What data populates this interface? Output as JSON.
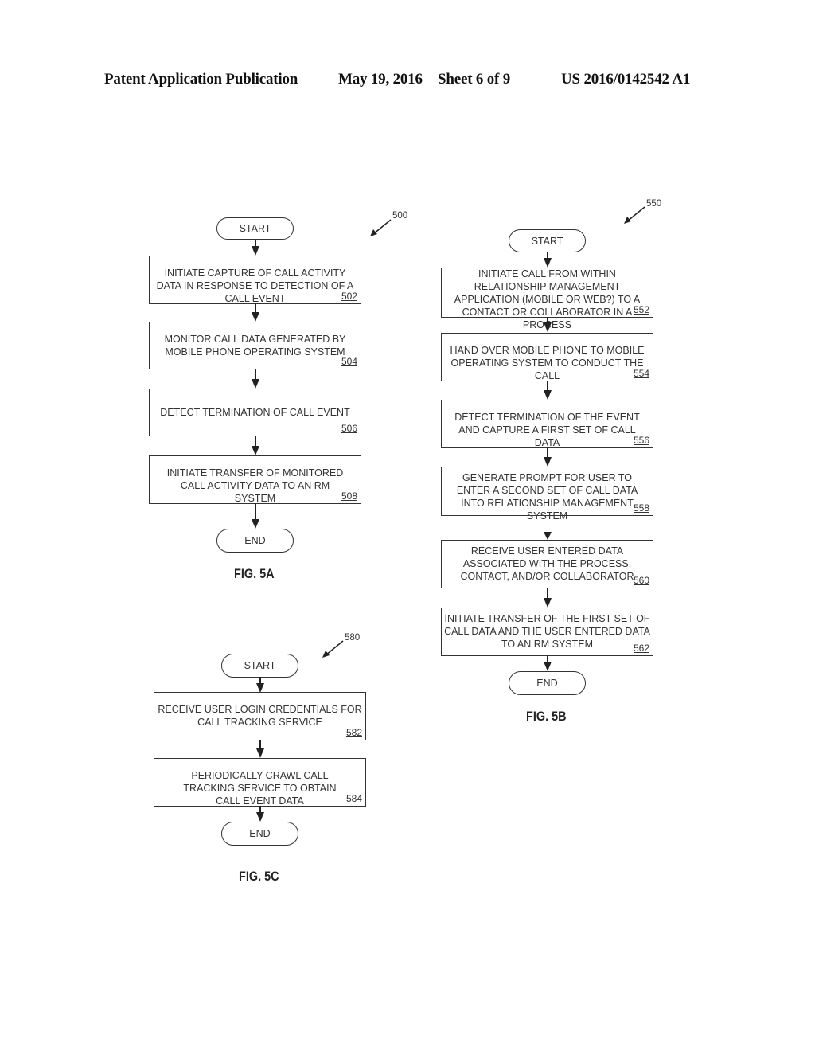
{
  "header": {
    "publication": "Patent Application Publication",
    "date": "May 19, 2016",
    "sheet": "Sheet 6 of 9",
    "number": "US 2016/0142542 A1"
  },
  "fig5a": {
    "ref": "500",
    "caption": "FIG. 5A",
    "start": "START",
    "end": "END",
    "steps": [
      {
        "text": "INITIATE CAPTURE OF CALL ACTIVITY DATA IN RESPONSE TO DETECTION OF A CALL EVENT",
        "ref": "502"
      },
      {
        "text": "MONITOR CALL DATA GENERATED BY MOBILE PHONE OPERATING SYSTEM",
        "ref": "504"
      },
      {
        "text": "DETECT TERMINATION OF CALL EVENT",
        "ref": "506"
      },
      {
        "text": "INITIATE TRANSFER OF MONITORED CALL ACTIVITY DATA TO AN RM SYSTEM",
        "ref": "508"
      }
    ]
  },
  "fig5b": {
    "ref": "550",
    "caption": "FIG. 5B",
    "start": "START",
    "end": "END",
    "steps": [
      {
        "text": "INITIATE CALL FROM WITHIN RELATIONSHIP MANAGEMENT APPLICATION (MOBILE OR WEB?) TO A CONTACT OR COLLABORATOR IN A PROCESS",
        "ref": "552"
      },
      {
        "text": "HAND OVER MOBILE PHONE TO MOBILE OPERATING SYSTEM TO CONDUCT THE CALL",
        "ref": "554"
      },
      {
        "text": "DETECT TERMINATION OF THE EVENT AND CAPTURE A FIRST SET OF CALL DATA",
        "ref": "556"
      },
      {
        "text": "GENERATE PROMPT FOR USER TO ENTER A SECOND SET OF CALL DATA INTO RELATIONSHIP MANAGEMENT SYSTEM",
        "ref": "558"
      },
      {
        "text": "RECEIVE USER ENTERED DATA ASSOCIATED WITH THE PROCESS, CONTACT, AND/OR COLLABORATOR",
        "ref": "560"
      },
      {
        "text": "INITIATE TRANSFER OF THE FIRST SET OF CALL DATA AND THE USER ENTERED DATA TO AN RM SYSTEM",
        "ref": "562"
      }
    ]
  },
  "fig5c": {
    "ref": "580",
    "caption": "FIG. 5C",
    "start": "START",
    "end": "END",
    "steps": [
      {
        "text": "RECEIVE USER LOGIN CREDENTIALS FOR CALL TRACKING SERVICE",
        "ref": "582"
      },
      {
        "text": "PERIODICALLY CRAWL CALL TRACKING SERVICE TO OBTAIN CALL EVENT DATA",
        "ref": "584"
      }
    ]
  }
}
